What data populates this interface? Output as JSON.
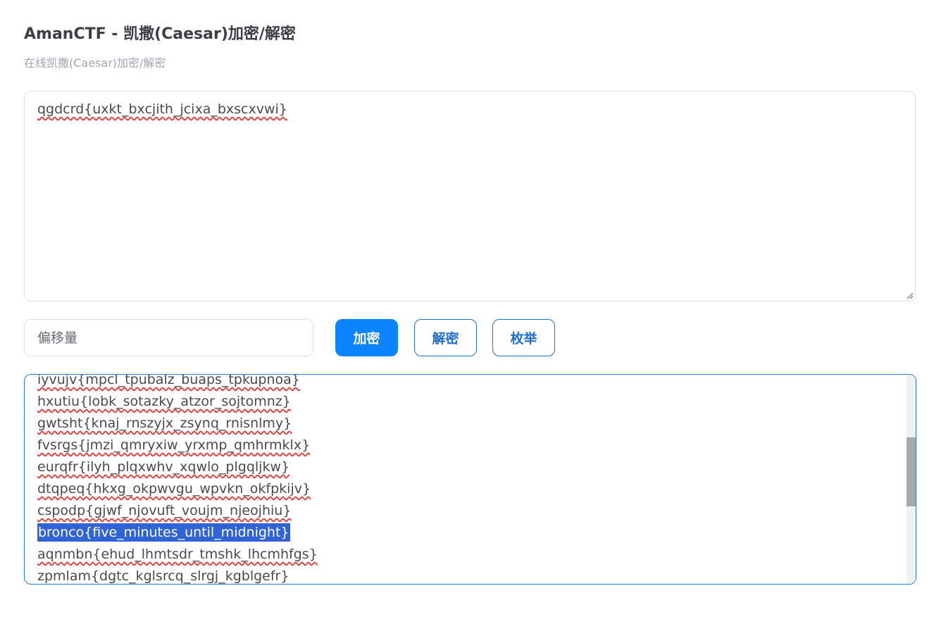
{
  "header": {
    "title": "AmanCTF - 凯撒(Caesar)加密/解密",
    "subtitle": "在线凯撒(Caesar)加密/解密"
  },
  "input": {
    "value": "qgdcrd{uxkt_bxcjith_jcixa_bxscxvwi}"
  },
  "controls": {
    "offset_placeholder": "偏移量",
    "encrypt_label": "加密",
    "decrypt_label": "解密",
    "enumerate_label": "枚举"
  },
  "output": {
    "lines": [
      "iyvujv{mpcl_tpubalz_buaps_tpkupnoa}",
      "hxutiu{lobk_sotazky_atzor_sojtomnz}",
      "gwtsht{knaj_rnszyjx_zsynq_rnisnlmy}",
      "fvsrgs{jmzi_qmryxiw_yrxmp_qmhrmklx}",
      "eurqfr{ilyh_plqxwhv_xqwlo_plgqljkw}",
      "dtqpeq{hkxg_okpwvgu_wpvkn_okfpkijv}",
      "cspodp{gjwf_njovuft_voujm_njeojhiu}",
      "bronco{five_minutes_until_midnight}",
      "aqnmbn{ehud_lhmtsdr_tmshk_lhcmhfgs}",
      "zpmlam{dgtc_kglsrcq_slrgj_kgblgefr}"
    ],
    "selected_index": 7
  },
  "colors": {
    "primary": "#0a84ff",
    "outline": "#1f6fcf",
    "selection": "#2f63d6",
    "spellcheck": "#e53935"
  }
}
